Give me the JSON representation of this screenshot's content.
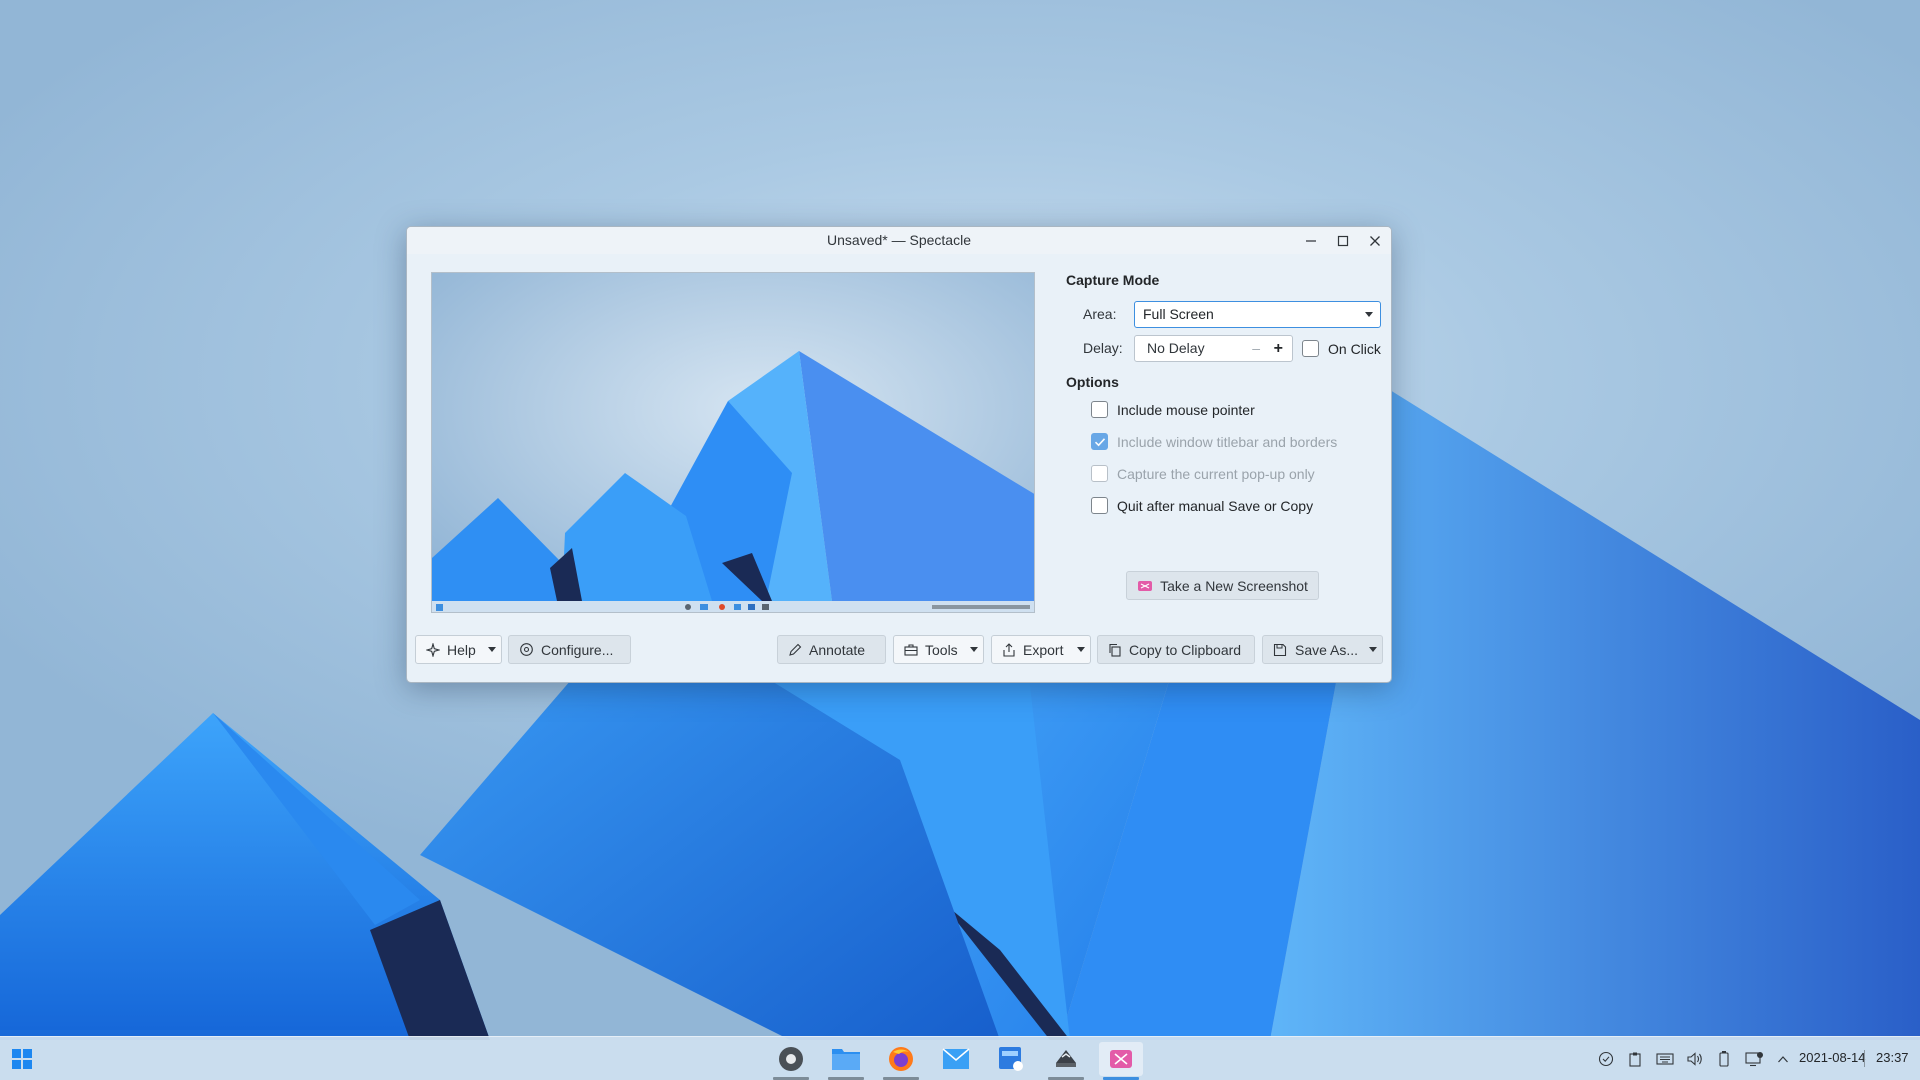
{
  "window": {
    "title": "Unsaved* — Spectacle"
  },
  "capture_mode": {
    "title": "Capture Mode",
    "area_label": "Area:",
    "area_value": "Full Screen",
    "delay_label": "Delay:",
    "delay_value": "No Delay",
    "on_click_label": "On Click",
    "on_click_checked": false
  },
  "options": {
    "title": "Options",
    "items": [
      {
        "label": "Include mouse pointer",
        "checked": false,
        "enabled": true
      },
      {
        "label": "Include window titlebar and borders",
        "checked": true,
        "enabled": false
      },
      {
        "label": "Capture the current pop-up only",
        "checked": false,
        "enabled": false
      },
      {
        "label": "Quit after manual Save or Copy",
        "checked": false,
        "enabled": true
      }
    ]
  },
  "take_screenshot_label": "Take a New Screenshot",
  "toolbar": {
    "help": "Help",
    "configure": "Configure...",
    "annotate": "Annotate",
    "tools": "Tools",
    "export": "Export",
    "copy": "Copy to Clipboard",
    "save_as": "Save As..."
  },
  "taskbar": {
    "apps": [
      "system-settings",
      "file-manager",
      "firefox",
      "mail",
      "discover",
      "ark",
      "spectacle"
    ],
    "active_app": "spectacle",
    "tray_icons": [
      "update-icon",
      "clipboard-icon",
      "keyboard-icon",
      "volume-icon",
      "battery-icon",
      "network-icon",
      "expand-tray-icon"
    ],
    "date": "2021-08-14",
    "time": "23:37"
  },
  "colors": {
    "accent": "#3d8fe0",
    "wallpaper_blue": "#1e7cf0"
  }
}
